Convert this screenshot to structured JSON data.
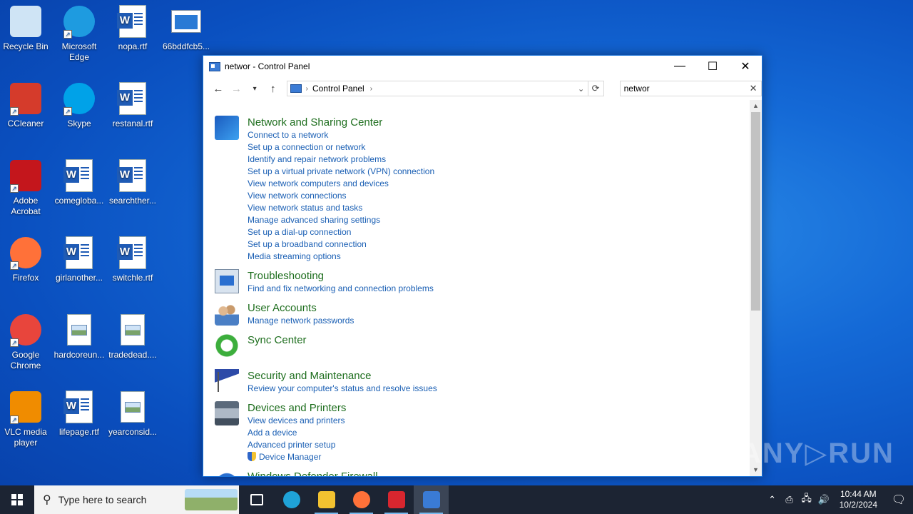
{
  "desktop": {
    "icons": [
      {
        "label": "Recycle Bin",
        "kind": "recycle-bin"
      },
      {
        "label": "Microsoft Edge",
        "kind": "edge"
      },
      {
        "label": "nopa.rtf",
        "kind": "word"
      },
      {
        "label": "66bddfcb5...",
        "kind": "window-app"
      },
      {
        "label": "CCleaner",
        "kind": "ccleaner"
      },
      {
        "label": "Skype",
        "kind": "skype"
      },
      {
        "label": "restanal.rtf",
        "kind": "word"
      },
      {
        "label": "Adobe Acrobat",
        "kind": "acrobat"
      },
      {
        "label": "comegloba...",
        "kind": "word"
      },
      {
        "label": "searchther...",
        "kind": "word"
      },
      {
        "label": "Firefox",
        "kind": "firefox"
      },
      {
        "label": "girlanother...",
        "kind": "word"
      },
      {
        "label": "switchle.rtf",
        "kind": "word"
      },
      {
        "label": "Google Chrome",
        "kind": "chrome"
      },
      {
        "label": "hardcoreun...",
        "kind": "image"
      },
      {
        "label": "tradedead....",
        "kind": "image"
      },
      {
        "label": "VLC media player",
        "kind": "vlc"
      },
      {
        "label": "lifepage.rtf",
        "kind": "word"
      },
      {
        "label": "yearconsid...",
        "kind": "image"
      }
    ]
  },
  "window": {
    "title": "networ - Control Panel",
    "minimize_glyph": "—",
    "maximize_glyph": "☐",
    "close_glyph": "✕",
    "address": {
      "crumb": "Control Panel"
    },
    "search": {
      "value": "networ"
    }
  },
  "results": [
    {
      "heading": "Network and Sharing Center",
      "icon": "network-icon",
      "links": [
        "Connect to a network",
        "Set up a connection or network",
        "Identify and repair network problems",
        "Set up a virtual private network (VPN) connection",
        "View network computers and devices",
        "View network connections",
        "View network status and tasks",
        "Manage advanced sharing settings",
        "Set up a dial-up connection",
        "Set up a broadband connection",
        "Media streaming options"
      ]
    },
    {
      "heading": "Troubleshooting",
      "icon": "troubleshooting-icon",
      "links": [
        "Find and fix networking and connection problems"
      ]
    },
    {
      "heading": "User Accounts",
      "icon": "user-accounts-icon",
      "links": [
        "Manage network passwords"
      ]
    },
    {
      "heading": "Sync Center",
      "icon": "sync-center-icon",
      "links": []
    },
    {
      "heading": "Security and Maintenance",
      "icon": "security-flag-icon",
      "links": [
        "Review your computer's status and resolve issues"
      ]
    },
    {
      "heading": "Devices and Printers",
      "icon": "printer-icon",
      "links": [
        "View devices and printers",
        "Add a device",
        "Advanced printer setup",
        "Device Manager"
      ]
    },
    {
      "heading": "Windows Defender Firewall",
      "icon": "firewall-icon",
      "links": []
    }
  ],
  "watermark": "ANY▷RUN",
  "taskbar": {
    "search_placeholder": "Type here to search",
    "apps": [
      {
        "name": "task-view",
        "color": "#ffffff"
      },
      {
        "name": "edge",
        "color": "#1fa3d8"
      },
      {
        "name": "file-explorer",
        "color": "#f2c230"
      },
      {
        "name": "firefox",
        "color": "#ff7139"
      },
      {
        "name": "fn-app",
        "color": "#d8262f"
      },
      {
        "name": "control-panel",
        "color": "#3a7bd5"
      }
    ],
    "time": "10:44 AM",
    "date": "10/2/2024"
  }
}
